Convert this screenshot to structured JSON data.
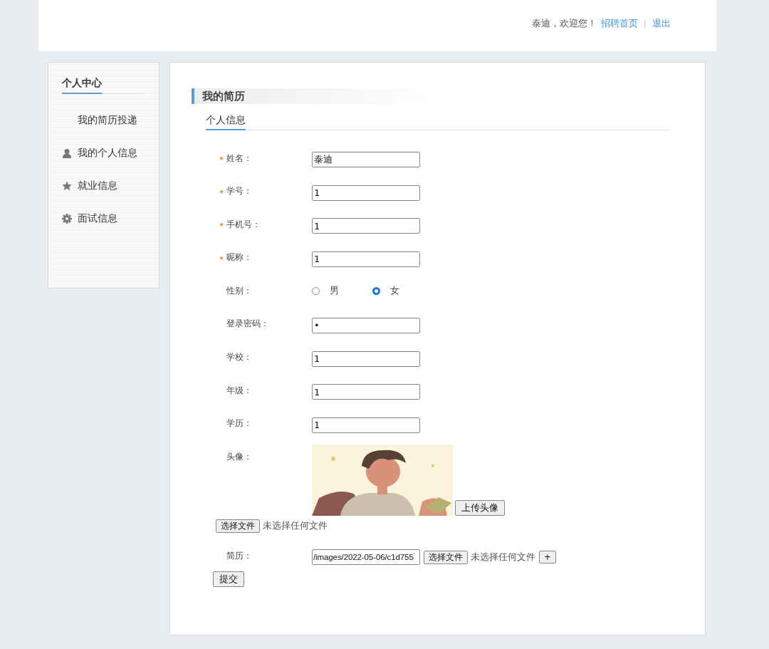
{
  "header": {
    "greeting": "泰迪，欢迎您！",
    "links": [
      {
        "label": "招聘首页"
      },
      {
        "label": "退出"
      }
    ],
    "separator": "|"
  },
  "sidebar": {
    "title": "个人中心",
    "items": [
      {
        "label": "我的简历投递",
        "kind": "none"
      },
      {
        "label": "我的个人信息",
        "kind": "person"
      },
      {
        "label": "就业信息",
        "kind": "star"
      },
      {
        "label": "面试信息",
        "kind": "gear"
      }
    ]
  },
  "main": {
    "title": "我的简历",
    "section": "个人信息",
    "fields": [
      {
        "kind": "text",
        "label": "姓名：",
        "required": true,
        "value": "泰迪"
      },
      {
        "kind": "text",
        "label": "学号：",
        "required": true,
        "value": "1"
      },
      {
        "kind": "text",
        "label": "手机号：",
        "required": true,
        "value": "1"
      },
      {
        "kind": "text",
        "label": "昵称：",
        "required": true,
        "value": "1"
      },
      {
        "kind": "radio",
        "label": "性别：",
        "required": false,
        "options": [
          {
            "label": "男",
            "selected": false
          },
          {
            "label": "女",
            "selected": true
          }
        ]
      },
      {
        "kind": "text",
        "label": "登录密码：",
        "required": false,
        "value": "•"
      },
      {
        "kind": "text",
        "label": "学校：",
        "required": false,
        "value": "1"
      },
      {
        "kind": "text",
        "label": "年级：",
        "required": false,
        "value": "1"
      },
      {
        "kind": "text",
        "label": "学历：",
        "required": false,
        "value": "1"
      },
      {
        "label": "头像：",
        "required": false,
        "upload_button": "上传头像",
        "choose_button": "选择文件",
        "file_status": "未选择任何文件"
      },
      {
        "kind": "file",
        "label": "简历：",
        "required": false,
        "value": "/images/2022-05-06/c1d755",
        "choose_button": "选择文件",
        "file_status": "未选择任何文件",
        "add_button": "+"
      }
    ],
    "submit": "提交"
  }
}
